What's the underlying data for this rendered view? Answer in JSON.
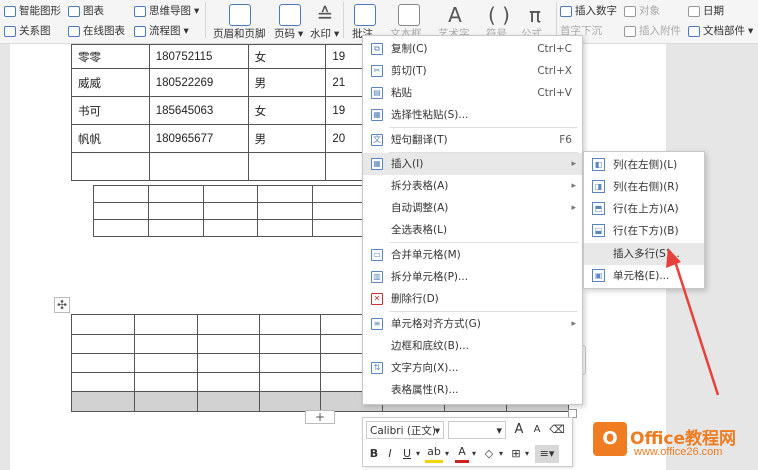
{
  "ribbon": {
    "smart_shape": "智能图形",
    "chart": "图表",
    "mindmap": "思维导图",
    "relation": "关系图",
    "online_chart": "在线图表",
    "flowchart": "流程图",
    "header_footer": "页眉和页脚",
    "page_number": "页码",
    "watermark": "水印",
    "comment": "批注",
    "textbox": "文本框",
    "wordart": "艺术字",
    "symbol": "符号",
    "formula": "公式",
    "insert_number": "插入数字",
    "object": "对象",
    "date": "日期",
    "first_letter": "首字下沉",
    "attachment": "插入附件",
    "doc_parts": "文档部件"
  },
  "table1": [
    [
      "零零",
      "180752115",
      "女",
      "19"
    ],
    [
      "威威",
      "180522269",
      "男",
      "21"
    ],
    [
      "书可",
      "185645063",
      "女",
      "19"
    ],
    [
      "帆帆",
      "180965677",
      "男",
      "20"
    ],
    [
      "",
      "",
      "",
      ""
    ]
  ],
  "context_menu": {
    "copy": "复制(C)",
    "copy_sc": "Ctrl+C",
    "cut": "剪切(T)",
    "cut_sc": "Ctrl+X",
    "paste": "粘贴",
    "paste_sc": "Ctrl+V",
    "paste_special": "选择性粘贴(S)...",
    "translate": "短句翻译(T)",
    "translate_sc": "F6",
    "insert": "插入(I)",
    "split_table": "拆分表格(A)",
    "autofit": "自动调整(A)",
    "select_table": "全选表格(L)",
    "merge_cells": "合并单元格(M)",
    "split_cells": "拆分单元格(P)...",
    "delete_row": "删除行(D)",
    "cell_align": "单元格对齐方式(G)",
    "borders": "边框和底纹(B)...",
    "text_dir": "文字方向(X)...",
    "table_props": "表格属性(R)..."
  },
  "submenu": {
    "col_left": "列(在左侧)(L)",
    "col_right": "列(在右侧)(R)",
    "row_above": "行(在上方)(A)",
    "row_below": "行(在下方)(B)",
    "insert_rows": "插入多行(S)...",
    "cell": "单元格(E)..."
  },
  "mini_toolbar": {
    "font": "Calibri (正文)",
    "bold": "B",
    "italic": "I",
    "underline": "U",
    "font_color": "A"
  },
  "watermark": {
    "title": "Office教程网",
    "url": "www.office26.com"
  },
  "colors": {
    "highlight": "#e8e8e8",
    "arrow": "#e8413b",
    "brand": "#f07c21",
    "shaded_row": "#d2d2d2"
  }
}
